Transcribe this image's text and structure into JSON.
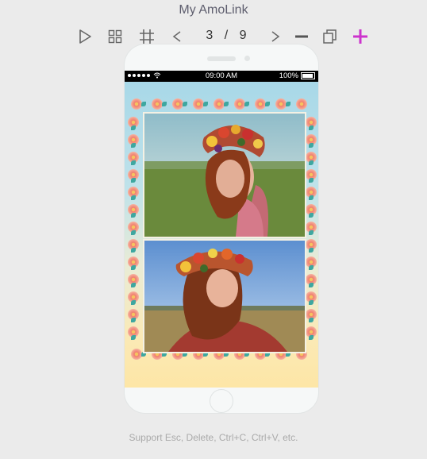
{
  "app": {
    "title": "My AmoLink"
  },
  "toolbar": {
    "play_icon": "play-icon",
    "grid_icon": "grid-icon",
    "hash_icon": "hash-grid-icon",
    "prev_icon": "chevron-left-icon",
    "next_icon": "chevron-right-icon",
    "remove_icon": "minus-icon",
    "duplicate_icon": "copy-icon",
    "add_icon": "plus-icon",
    "current_page": "3",
    "separator": "/",
    "total_pages": "9",
    "accent_color": "#cc33cc"
  },
  "phone": {
    "status": {
      "carrier_dots": "●●●●●",
      "time": "09:00  AM",
      "battery": "100%"
    }
  },
  "footer": {
    "hint": "Support Esc, Delete, Ctrl+C, Ctrl+V, etc."
  }
}
